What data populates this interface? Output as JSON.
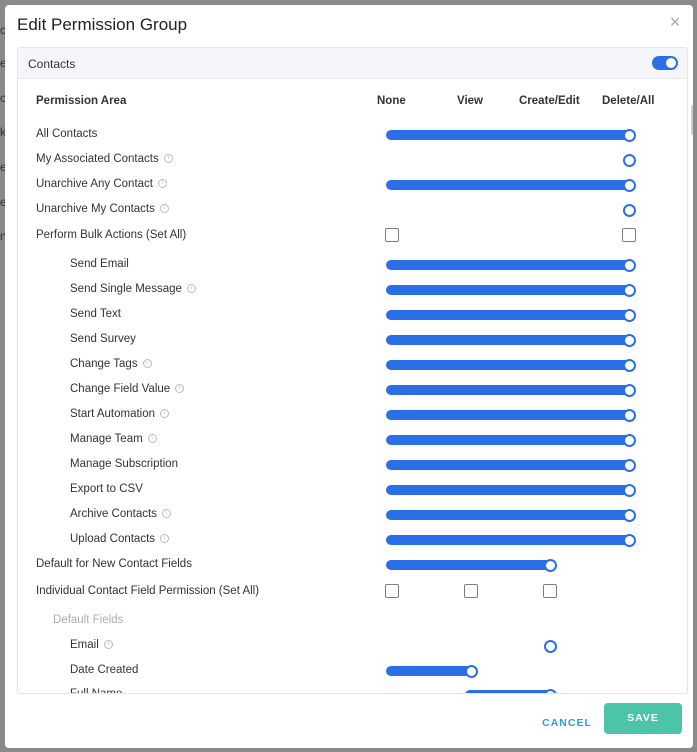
{
  "modal": {
    "title": "Edit Permission Group",
    "close_icon": "×"
  },
  "section": {
    "title": "Contacts",
    "enabled": true
  },
  "columns": [
    "Permission Area",
    "None",
    "View",
    "Create/Edit",
    "Delete/All"
  ],
  "rows": [
    {
      "label": "All Contacts",
      "info": false,
      "level": 0,
      "kind": "slider",
      "value": "Delete/All"
    },
    {
      "label": "My Associated Contacts",
      "info": true,
      "level": 0,
      "kind": "knob",
      "value": "Delete/All"
    },
    {
      "label": "Unarchive Any Contact",
      "info": true,
      "level": 0,
      "kind": "slider",
      "value": "Delete/All"
    },
    {
      "label": "Unarchive My Contacts",
      "info": true,
      "level": 0,
      "kind": "knob",
      "value": "Delete/All"
    },
    {
      "label": "Perform Bulk Actions (Set All)",
      "info": false,
      "level": 0,
      "kind": "checkbox",
      "value": "None"
    },
    {
      "label": "Send Email",
      "info": false,
      "level": 1,
      "kind": "slider",
      "value": "Delete/All"
    },
    {
      "label": "Send Single Message",
      "info": true,
      "level": 1,
      "kind": "slider",
      "value": "Delete/All"
    },
    {
      "label": "Send Text",
      "info": false,
      "level": 1,
      "kind": "slider",
      "value": "Delete/All"
    },
    {
      "label": "Send Survey",
      "info": false,
      "level": 1,
      "kind": "slider",
      "value": "Delete/All"
    },
    {
      "label": "Change Tags",
      "info": true,
      "level": 1,
      "kind": "slider",
      "value": "Delete/All"
    },
    {
      "label": "Change Field Value",
      "info": true,
      "level": 1,
      "kind": "slider",
      "value": "Delete/All"
    },
    {
      "label": "Start Automation",
      "info": true,
      "level": 1,
      "kind": "slider",
      "value": "Delete/All"
    },
    {
      "label": "Manage Team",
      "info": true,
      "level": 1,
      "kind": "slider",
      "value": "Delete/All"
    },
    {
      "label": "Manage Subscription",
      "info": false,
      "level": 1,
      "kind": "slider",
      "value": "Delete/All"
    },
    {
      "label": "Export to CSV",
      "info": false,
      "level": 1,
      "kind": "slider",
      "value": "Delete/All"
    },
    {
      "label": "Archive Contacts",
      "info": true,
      "level": 1,
      "kind": "slider",
      "value": "Delete/All"
    },
    {
      "label": "Upload Contacts",
      "info": true,
      "level": 1,
      "kind": "slider",
      "value": "Delete/All"
    },
    {
      "label": "Default for New Contact Fields",
      "info": false,
      "level": 0,
      "kind": "slider",
      "value": "Create/Edit"
    },
    {
      "label": "Individual Contact Field Permission (Set All)",
      "info": false,
      "level": 0,
      "kind": "checkbox3",
      "value": "None"
    },
    {
      "label": "Default Fields",
      "info": false,
      "level": 2,
      "kind": "subheader",
      "value": ""
    },
    {
      "label": "Email",
      "info": true,
      "level": 1,
      "kind": "knob",
      "value": "Create/Edit"
    },
    {
      "label": "Date Created",
      "info": false,
      "level": 1,
      "kind": "slider",
      "value": "View"
    },
    {
      "label": "Full Name",
      "info": false,
      "level": 1,
      "kind": "slider-partial",
      "value": "Create/Edit"
    }
  ],
  "footer": {
    "cancel_label": "CANCEL",
    "save_label": "SAVE"
  },
  "backdrop_fragments": [
    "c",
    "e",
    "c",
    "k",
    "e",
    "e",
    "n"
  ],
  "colors": {
    "accent": "#2b6fe8",
    "save": "#4cc4a8",
    "cancel": "#2b9fd0"
  }
}
